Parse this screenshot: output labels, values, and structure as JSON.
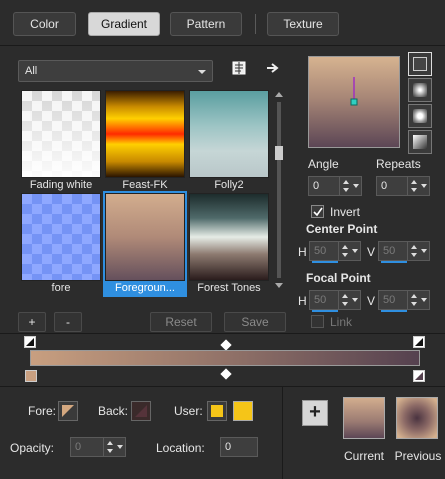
{
  "tabs": [
    {
      "label": "Color",
      "active": false
    },
    {
      "label": "Gradient",
      "active": true
    },
    {
      "label": "Pattern",
      "active": false
    },
    {
      "label": "Texture",
      "active": false
    }
  ],
  "filter": {
    "selected": "All"
  },
  "swatches": [
    {
      "label": "Fading white",
      "style": "checker"
    },
    {
      "label": "Feast-FK",
      "style": "feast"
    },
    {
      "label": "Folly2",
      "style": "folly"
    },
    {
      "label": "fore",
      "style": "checkblue"
    },
    {
      "label": "Foregroun...",
      "style": "foreground",
      "selected": true
    },
    {
      "label": "Forest Tones",
      "style": "forest"
    }
  ],
  "buttons": {
    "add": "+",
    "remove": "-",
    "reset": "Reset",
    "save": "Save"
  },
  "angle": {
    "label": "Angle",
    "value": "0"
  },
  "repeats": {
    "label": "Repeats",
    "value": "0"
  },
  "invert": {
    "label": "Invert",
    "checked": true
  },
  "center_point": {
    "label": "Center Point",
    "h_label": "H",
    "h_value": "50",
    "v_label": "V",
    "v_value": "50"
  },
  "focal_point": {
    "label": "Focal Point",
    "h_label": "H",
    "h_value": "50",
    "v_label": "V",
    "v_value": "50"
  },
  "link": {
    "label": "Link",
    "checked": false
  },
  "stops": {
    "fore_label": "Fore:",
    "back_label": "Back:",
    "user_label": "User:",
    "user_color": "#f5c518",
    "opacity_label": "Opacity:",
    "opacity_value": "0",
    "location_label": "Location:",
    "location_value": "0"
  },
  "result": {
    "add_label": "+",
    "current_label": "Current",
    "previous_label": "Previous"
  },
  "colors": {
    "accent": "#2f8fe0",
    "gradient_start": "#c89f80",
    "gradient_mid": "#8c6e66",
    "gradient_end": "#55414f"
  }
}
